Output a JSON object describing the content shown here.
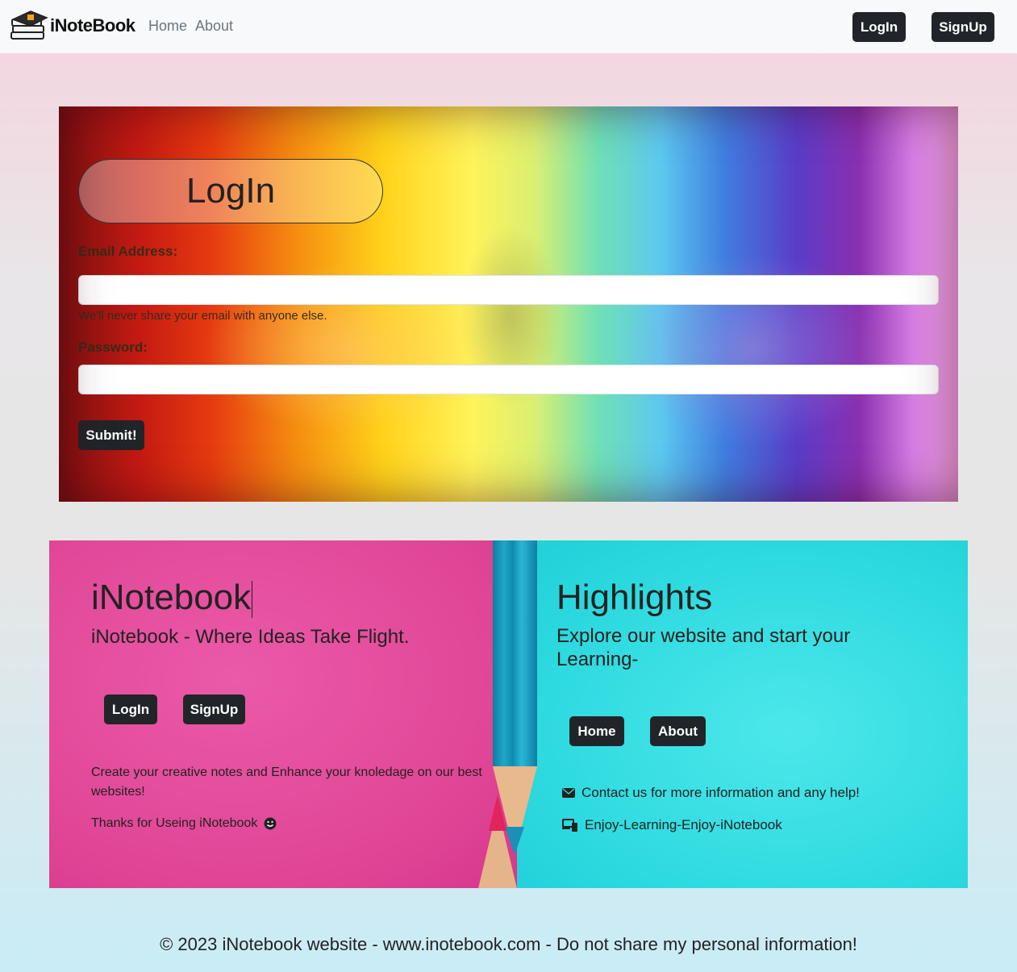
{
  "navbar": {
    "brand": "iNoteBook",
    "links": [
      "Home",
      "About"
    ],
    "login_button": "LogIn",
    "signup_button": "SignUp"
  },
  "login_form": {
    "title": "LogIn",
    "email_label": "Email Address:",
    "email_value": "",
    "email_help": "We'll never share your email with anyone else.",
    "password_label": "Password:",
    "password_value": "",
    "submit_button": "Submit!"
  },
  "footer_left": {
    "title": "iNotebook",
    "tagline": "iNotebook - Where Ideas Take Flight.",
    "login_button": "LogIn",
    "signup_button": "SignUp",
    "description": "Create your creative notes and Enhance your knoledage on our best websites!",
    "thanks": "Thanks for Useing iNotebook"
  },
  "footer_right": {
    "title": "Highlights",
    "subtitle": "Explore our website and start your Learning-",
    "home_button": "Home",
    "about_button": "About",
    "contact_text": "Contact us for more information and any help!",
    "enjoy_text": "Enjoy-Learning-Enjoy-iNotebook"
  },
  "copyright": "© 2023 iNotebook website - www.inotebook.com - Do not share my personal information!",
  "icons": {
    "brand": "books-icon",
    "contact": "envelope-icon",
    "enjoy": "devices-icon",
    "thanks": "smile-icon"
  },
  "colors": {
    "dark_button": "#212529",
    "pink_panel": "#e04595",
    "cyan_panel": "#2fdbe0"
  }
}
